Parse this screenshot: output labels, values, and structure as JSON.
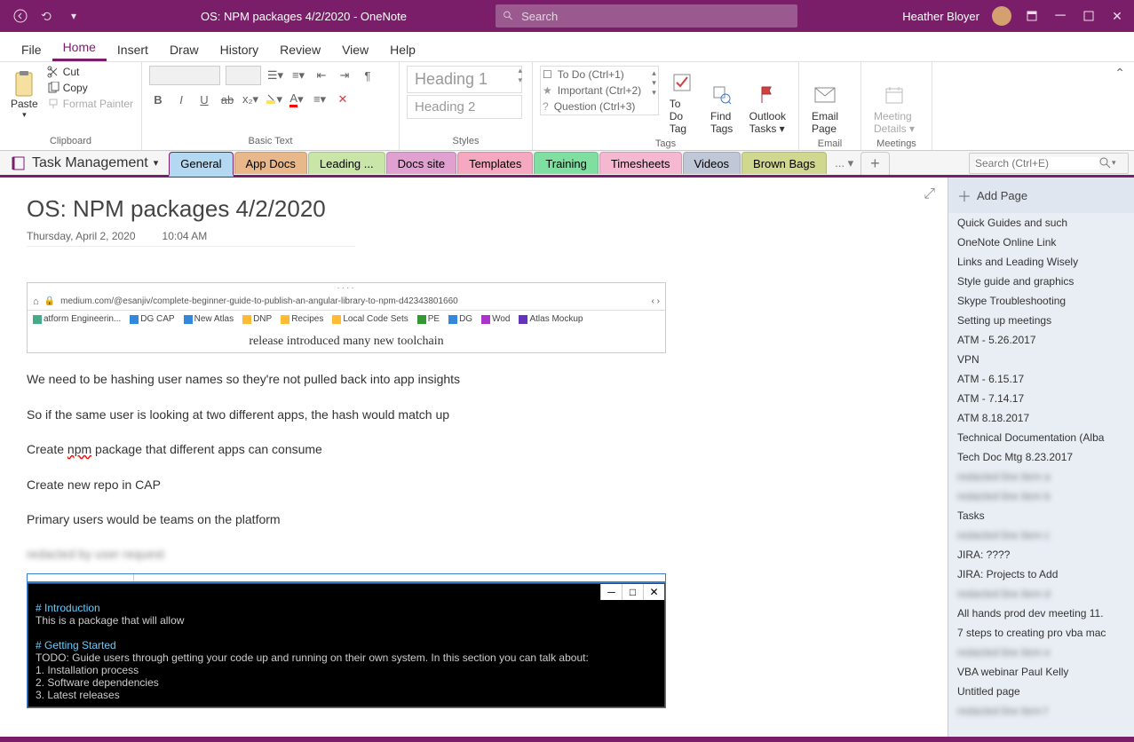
{
  "titlebar": {
    "title": "OS: NPM packages 4/2/2020  -  OneNote",
    "search_placeholder": "Search",
    "user": "Heather Bloyer"
  },
  "ribbon_tabs": [
    "File",
    "Home",
    "Insert",
    "Draw",
    "History",
    "Review",
    "View",
    "Help"
  ],
  "active_tab": "Home",
  "ribbon": {
    "paste": "Paste",
    "cut": "Cut",
    "copy": "Copy",
    "format_painter": "Format Painter",
    "clipboard_label": "Clipboard",
    "basic_text_label": "Basic Text",
    "styles_label": "Styles",
    "heading1": "Heading 1",
    "heading2": "Heading 2",
    "tags_label": "Tags",
    "tag_todo": "To Do (Ctrl+1)",
    "tag_important": "Important (Ctrl+2)",
    "tag_question": "Question (Ctrl+3)",
    "todo_tag": "To Do Tag",
    "find_tags": "Find Tags",
    "outlook_tasks": "Outlook Tasks",
    "email_page": "Email Page",
    "email_label": "Email",
    "meeting_details": "Meeting Details",
    "meetings_label": "Meetings"
  },
  "notebook": "Task Management",
  "sections": [
    {
      "label": "General",
      "bg": "#b3d9f2",
      "active": true
    },
    {
      "label": "App Docs",
      "bg": "#e8b88a"
    },
    {
      "label": "Leading ...",
      "bg": "#c9e6a8"
    },
    {
      "label": "Docs site",
      "bg": "#e0a0d0"
    },
    {
      "label": "Templates",
      "bg": "#f5a8c0"
    },
    {
      "label": "Training",
      "bg": "#7edfa0"
    },
    {
      "label": "Timesheets",
      "bg": "#f5b8d0"
    },
    {
      "label": "Videos",
      "bg": "#c0c8d8"
    },
    {
      "label": "Brown Bags",
      "bg": "#d0d890"
    }
  ],
  "page_search_placeholder": "Search (Ctrl+E)",
  "page": {
    "title": "OS: NPM packages 4/2/2020",
    "date": "Thursday, April 2, 2020",
    "time": "10:04 AM"
  },
  "embed": {
    "url": "medium.com/@esanjiv/complete-beginner-guide-to-publish-an-angular-library-to-npm-d42343801660",
    "bookmarks": [
      "atform Engineerin...",
      "DG CAP",
      "New Atlas",
      "DNP",
      "Recipes",
      "Local Code Sets",
      "PE",
      "DG",
      "Wod",
      "Atlas Mockup"
    ],
    "snippet": "release introduced many new toolchain"
  },
  "note_lines": [
    "We need to be hashing user names so they're not pulled back into app insights",
    "So if the same user is looking at two different apps, the hash would match up",
    "Create npm package that different apps can consume",
    "Create new repo in CAP",
    "Primary users would be teams on the platform"
  ],
  "terminal": [
    "# Introduction",
    "This is a package that will allow",
    "",
    "# Getting Started",
    "TODO: Guide users through getting your code up and running on their own system. In this section you can talk about:",
    "1.    Installation process",
    "2.    Software dependencies",
    "3.    Latest releases"
  ],
  "add_page": "Add Page",
  "page_list": [
    {
      "label": "Quick Guides and such"
    },
    {
      "label": "OneNote Online Link"
    },
    {
      "label": "Links and Leading Wisely"
    },
    {
      "label": "Style guide and graphics"
    },
    {
      "label": "Skype Troubleshooting"
    },
    {
      "label": "Setting up meetings"
    },
    {
      "label": "ATM - 5.26.2017"
    },
    {
      "label": "VPN"
    },
    {
      "label": "ATM - 6.15.17"
    },
    {
      "label": "ATM - 7.14.17"
    },
    {
      "label": "ATM 8.18.2017"
    },
    {
      "label": "Technical Documentation (Alba"
    },
    {
      "label": "Tech Doc Mtg 8.23.2017"
    },
    {
      "label": "redacted line item a",
      "blur": true
    },
    {
      "label": "redacted line item b",
      "blur": true
    },
    {
      "label": "Tasks"
    },
    {
      "label": "redacted line item c",
      "blur": true
    },
    {
      "label": "JIRA: ????"
    },
    {
      "label": "JIRA: Projects to Add"
    },
    {
      "label": "redacted line item d",
      "blur": true
    },
    {
      "label": "All hands prod dev meeting 11."
    },
    {
      "label": "7 steps to creating pro vba mac"
    },
    {
      "label": "redacted line item e",
      "blur": true
    },
    {
      "label": "VBA webinar Paul Kelly"
    },
    {
      "label": "Untitled page"
    },
    {
      "label": "redacted line item f",
      "blur": true
    }
  ]
}
